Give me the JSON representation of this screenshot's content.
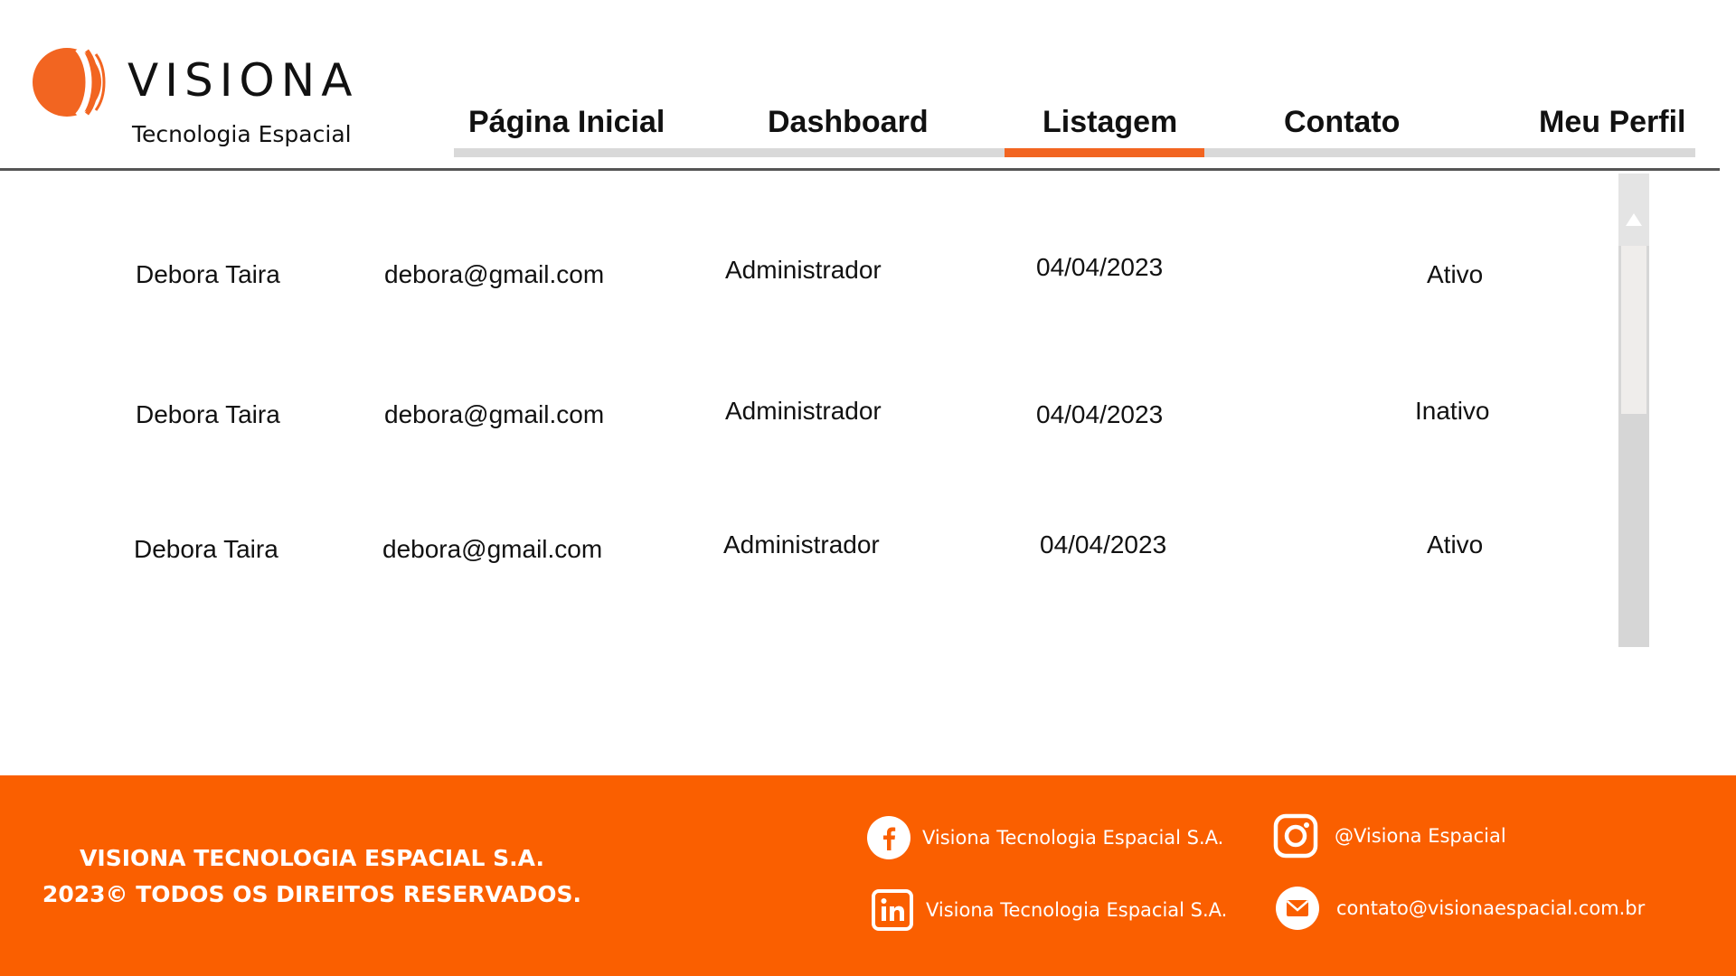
{
  "brand": {
    "name": "VISIONA",
    "tagline": "Tecnologia Espacial",
    "accent": "#f26521",
    "footer_bg": "#fa5f00"
  },
  "nav": {
    "items": [
      {
        "label": "Página Inicial"
      },
      {
        "label": "Dashboard"
      },
      {
        "label": "Listagem",
        "active": true
      },
      {
        "label": "Contato"
      },
      {
        "label": "Meu Perfil"
      }
    ]
  },
  "users": [
    {
      "name": "Debora Taira",
      "email": "debora@gmail.com",
      "role": "Administrador",
      "date": "04/04/2023",
      "status": "Ativo"
    },
    {
      "name": "Debora Taira",
      "email": "debora@gmail.com",
      "role": "Administrador",
      "date": "04/04/2023",
      "status": "Inativo"
    },
    {
      "name": "Debora Taira",
      "email": "debora@gmail.com",
      "role": "Administrador",
      "date": "04/04/2023",
      "status": "Ativo"
    }
  ],
  "footer": {
    "company": "VISIONA TECNOLOGIA ESPACIAL S.A.",
    "rights": "2023© TODOS OS DIREITOS RESERVADOS.",
    "facebook": "Visiona Tecnologia Espacial S.A.",
    "linkedin": "Visiona Tecnologia Espacial S.A.",
    "instagram": "@Visiona Espacial",
    "email": "contato@visionaespacial.com.br"
  },
  "icons": {
    "facebook": "facebook-icon",
    "linkedin": "linkedin-icon",
    "instagram": "instagram-icon",
    "email": "mail-icon",
    "scroll_up": "triangle-up-icon"
  }
}
